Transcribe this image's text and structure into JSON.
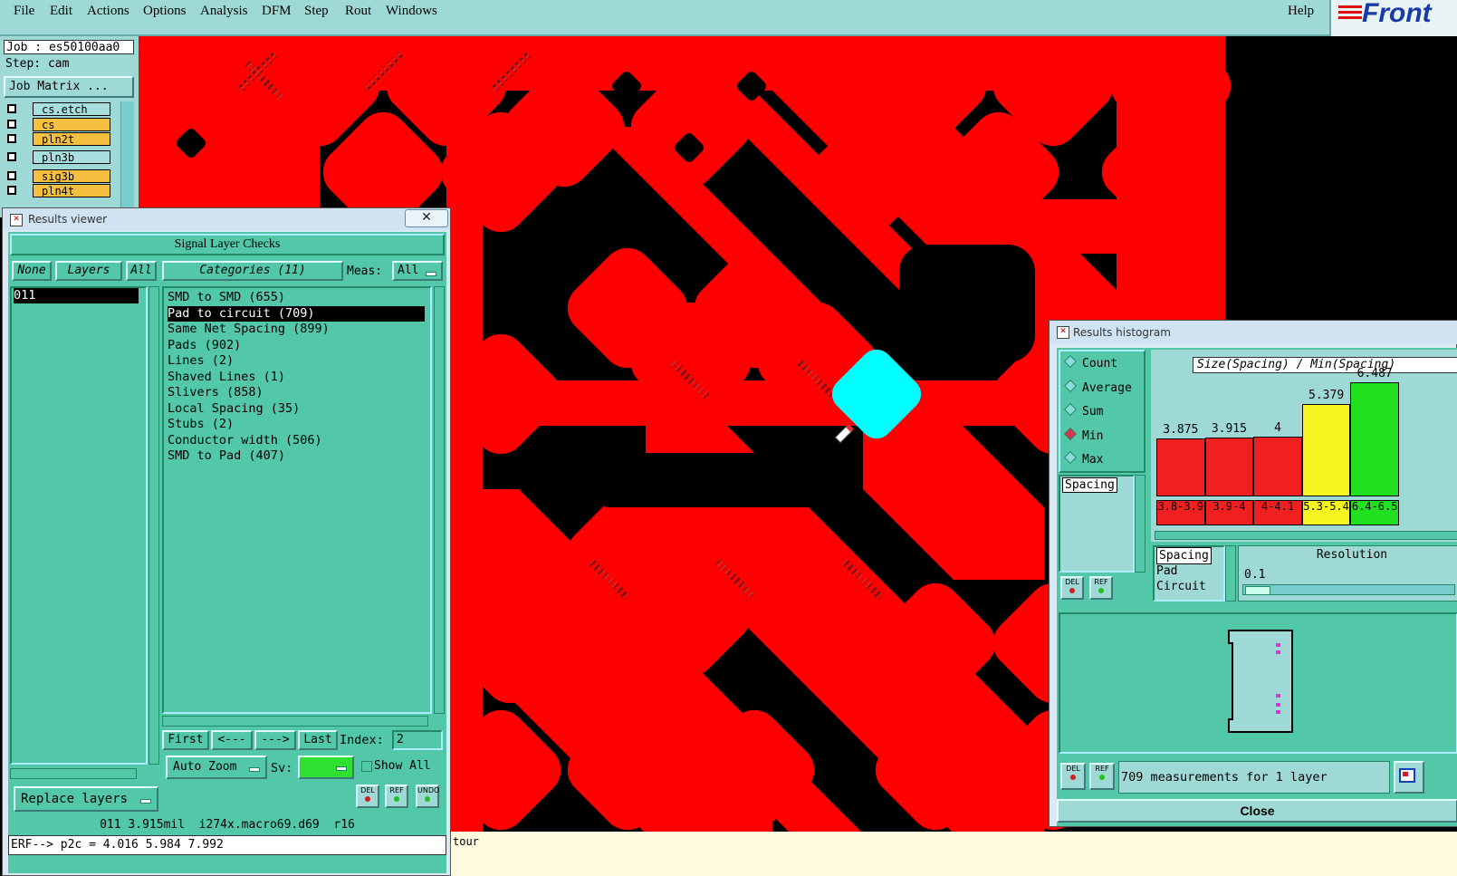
{
  "menu": {
    "items": [
      "File",
      "Edit",
      "Actions",
      "Options",
      "Analysis",
      "DFM",
      "Step",
      "Rout",
      "Windows"
    ],
    "help": "Help",
    "brand": "Front"
  },
  "left_panel": {
    "job": "Job : es50100aa0",
    "step": "Step: cam",
    "job_matrix": "Job Matrix ...",
    "layers": [
      {
        "name": "cs.etch",
        "color": "#a8e0e0"
      },
      {
        "name": "cs",
        "color": "#f5c040"
      },
      {
        "name": "pln2t",
        "color": "#f5c040"
      },
      {
        "name": "pln3b",
        "color": "#a8e0e0"
      },
      {
        "name": "sig3b",
        "color": "#f5c040"
      },
      {
        "name": "pln4t",
        "color": "#f5c040"
      }
    ]
  },
  "results_viewer": {
    "title": "Results viewer",
    "header": "Signal Layer Checks",
    "none_btn": "None",
    "layers_btn": "Layers",
    "all_btn": "All",
    "categories_btn": "Categories (11)",
    "meas_label": "Meas:",
    "meas_value": "All",
    "layer_list": [
      "011"
    ],
    "categories": [
      "SMD to SMD (655)",
      "Pad to circuit (709)",
      "Same Net Spacing (899)",
      "Pads (902)",
      "Lines (2)",
      "Shaved Lines (1)",
      "Slivers (858)",
      "Local Spacing (35)",
      "Stubs (2)",
      "Conductor width (506)",
      "SMD to Pad (407)"
    ],
    "selected_category_index": 1,
    "nav": {
      "first": "First",
      "prev": "<---",
      "next": "--->",
      "last": "Last",
      "index_label": "Index:",
      "index_value": "2"
    },
    "auto_zoom": "Auto Zoom",
    "sv_label": "Sv:",
    "show_all": "Show All",
    "replace_layers": "Replace layers",
    "icons": {
      "del": "DEL",
      "ref": "REF",
      "undo": "UNDO"
    },
    "status_line": "011 3.915mil  i274x.macro69.d69  r16",
    "erf_line": "ERF--> p2c = 4.016 5.984 7.992"
  },
  "bottom_status": "tour",
  "histogram": {
    "title": "Results histogram",
    "modes": [
      "Count",
      "Average",
      "Sum",
      "Min",
      "Max"
    ],
    "selected_mode": "Min",
    "chart_title": "Size(Spacing) / Min(Spacing)",
    "left_list": [
      "Spacing"
    ],
    "attr_list": [
      "Spacing",
      "Pad",
      "Circuit"
    ],
    "resolution_label": "Resolution",
    "resolution_value": "0.1",
    "summary": "709 measurements for 1 layer",
    "close": "Close",
    "icons": {
      "del": "DEL",
      "ref": "REF"
    }
  },
  "chart_data": {
    "type": "bar",
    "title": "Size(Spacing) / Min(Spacing)",
    "categories": [
      "3.8-3.9",
      "3.9-4",
      "4-4.1",
      "5.3-5.4",
      "6.4-6.5"
    ],
    "values": [
      3.875,
      3.915,
      4,
      5.379,
      6.487
    ],
    "value_labels": [
      "3.875",
      "3.915",
      "4",
      "5.379",
      "6.487"
    ],
    "colors": [
      "#f02020",
      "#f02020",
      "#f02020",
      "#f5f520",
      "#20e020"
    ],
    "ylim": [
      0,
      6.487
    ]
  }
}
